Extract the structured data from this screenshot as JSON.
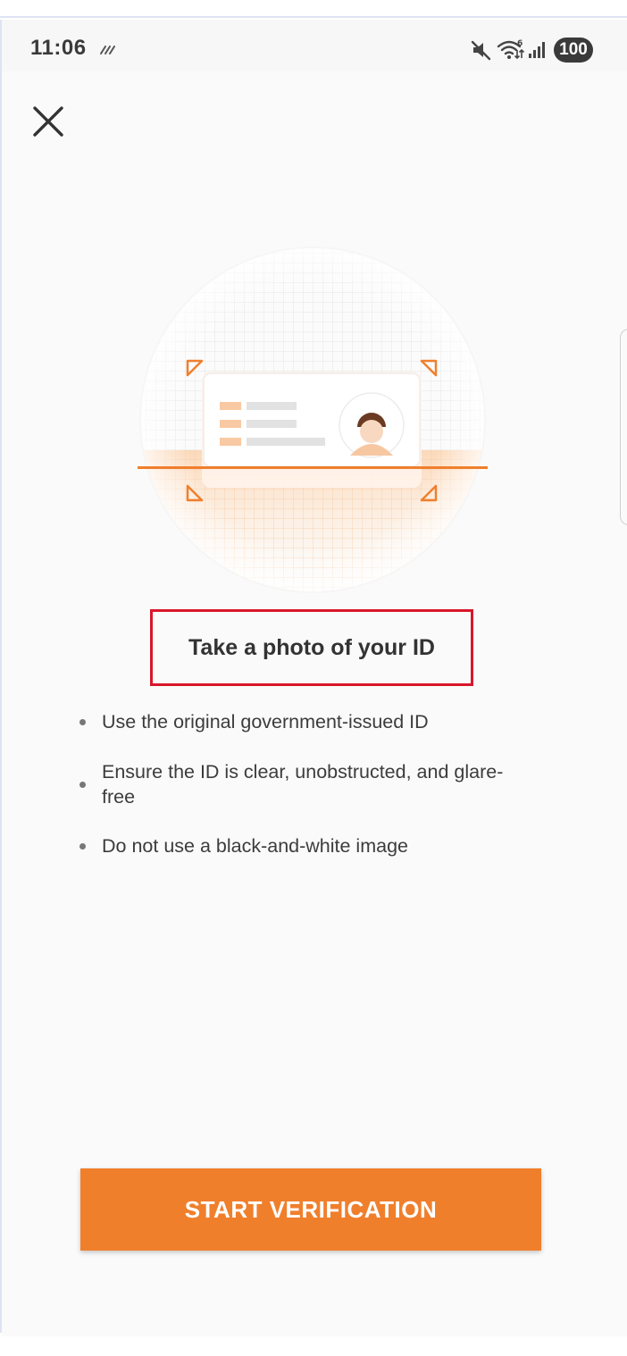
{
  "status_bar": {
    "time": "11:06",
    "battery": "100",
    "icons": [
      "signal-quality-icon",
      "mute-icon",
      "wifi-icon",
      "cell-signal-icon",
      "battery-icon"
    ]
  },
  "nav": {
    "close_icon": "close-icon"
  },
  "illustration": {
    "name": "id-card-scan-illustration",
    "accent_color": "#f07f2c"
  },
  "main": {
    "title": "Take a photo of your ID",
    "tips": [
      "Use the original government-issued ID",
      "Ensure the ID is clear, unobstructed, and glare-free",
      "Do not use a black-and-white image"
    ]
  },
  "action": {
    "start_label": "START VERIFICATION",
    "color": "#f07f2c"
  },
  "colors": {
    "highlight_border": "#d8172b",
    "background": "#fafafa"
  }
}
